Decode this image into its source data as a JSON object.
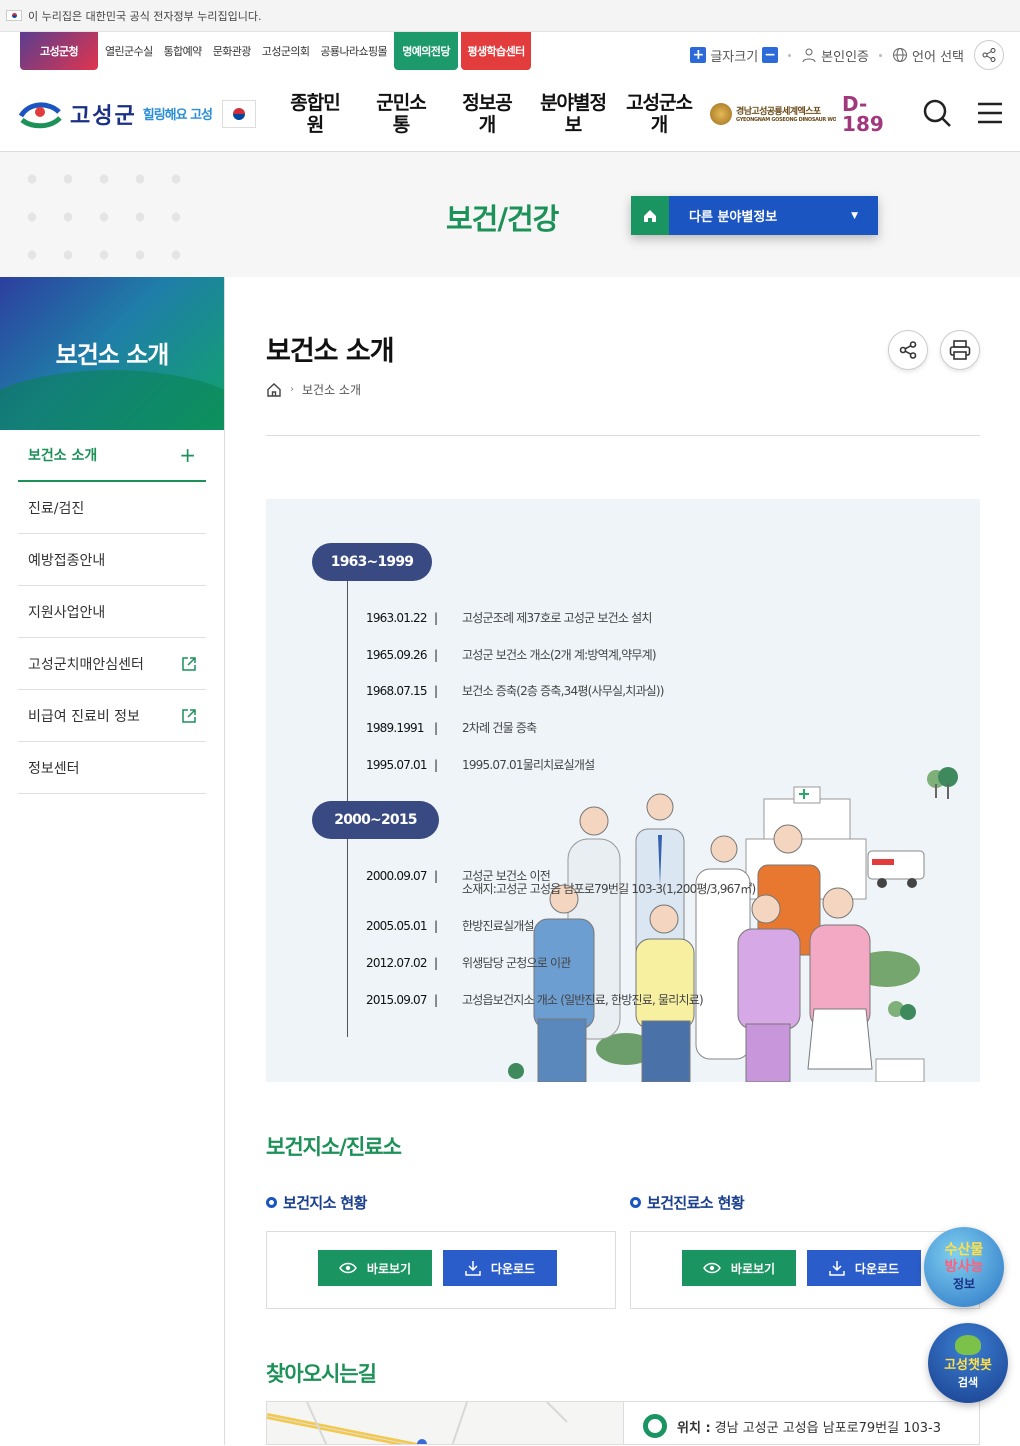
{
  "gov_notice": "이 누리집은 대한민국 공식 전자정부 누리집입니다.",
  "quick_links": [
    "고성군청",
    "열린군수실",
    "통합예약",
    "문화관광",
    "고성군의회",
    "공룡나라쇼핑몰",
    "명예의전당",
    "평생학습센터"
  ],
  "utils": {
    "font_size": "글자크기",
    "font_plus": "+",
    "font_minus": "−",
    "auth": "본인인증",
    "language": "언어 선택"
  },
  "logo": {
    "name": "고성군",
    "slogan": "힐링해요 고성"
  },
  "gnb": [
    {
      "line1": "종합민",
      "line2": "원"
    },
    {
      "line1": "군민소",
      "line2": "통"
    },
    {
      "line1": "정보공",
      "line2": "개"
    },
    {
      "line1": "분야별정",
      "line2": "보"
    },
    {
      "line1": "고성군소",
      "line2": "개"
    }
  ],
  "expo": {
    "name": "경남고성공룡세계엑스포",
    "sub": "GYEONGNAM GOSEONG DINOSAUR WORLD EXPO",
    "dday1": "D-",
    "dday2": "189"
  },
  "banner": {
    "title": "보건/건강",
    "other_label": "다른 분야별정보"
  },
  "lnb": {
    "title": "보건소 소개",
    "items": [
      {
        "label": "보건소 소개",
        "icon": "plus"
      },
      {
        "label": "진료/검진",
        "icon": ""
      },
      {
        "label": "예방접종안내",
        "icon": ""
      },
      {
        "label": "지원사업안내",
        "icon": ""
      },
      {
        "label": "고성군치매안심센터",
        "icon": "external-link"
      },
      {
        "label": "비급여 진료비 정보",
        "icon": "external-link"
      },
      {
        "label": "정보센터",
        "icon": ""
      }
    ]
  },
  "page": {
    "title": "보건소 소개",
    "breadcrumb": "보건소 소개"
  },
  "history": {
    "era1": "1963~1999",
    "era2": "2000~2015",
    "events": [
      {
        "date": "1963.01.22",
        "text": "고성군조례 제37호로 고성군 보건소 설치"
      },
      {
        "date": "1965.09.26",
        "text": "고성군 보건소 개소(2개 계:방역계,약무계)"
      },
      {
        "date": "1968.07.15",
        "text": "보건소 증축(2층 증축,34평(사무실,치과실))"
      },
      {
        "date": "1989.1991",
        "text": "2차례 건물 증축"
      },
      {
        "date": "1995.07.01",
        "text": "1995.07.01물리치료실개설"
      },
      {
        "date": "2000.09.07",
        "text": "고성군 보건소 이전",
        "text2": "소재지:고성군 고성읍 남포로79번길 103-3(1,200평/3,967㎡)"
      },
      {
        "date": "2005.05.01",
        "text": "한방진료실개설"
      },
      {
        "date": "2012.07.02",
        "text": "위생담당 군청으로 이관"
      },
      {
        "date": "2015.09.07",
        "text": "고성읍보건지소 개소 (일반진료, 한방진료, 물리치료)"
      }
    ]
  },
  "branch": {
    "section": "보건지소/진료소",
    "left_title": "보건지소 현황",
    "right_title": "보건진료소 현황",
    "view": "바로보기",
    "download": "다운로드"
  },
  "directions": {
    "section": "찾아오시는길",
    "addr_label": "위치 :",
    "addr": "경남 고성군 고성읍 남포로79번길 103-3"
  },
  "floating": {
    "btn1": {
      "l1": "수산물",
      "l2": "방사능",
      "l3": "정보"
    },
    "btn2": {
      "l1": "고성챗봇",
      "l2": "검색"
    }
  },
  "colors": {
    "green": "#1c9158",
    "blue": "#1a55c2",
    "navy": "#394a83"
  }
}
